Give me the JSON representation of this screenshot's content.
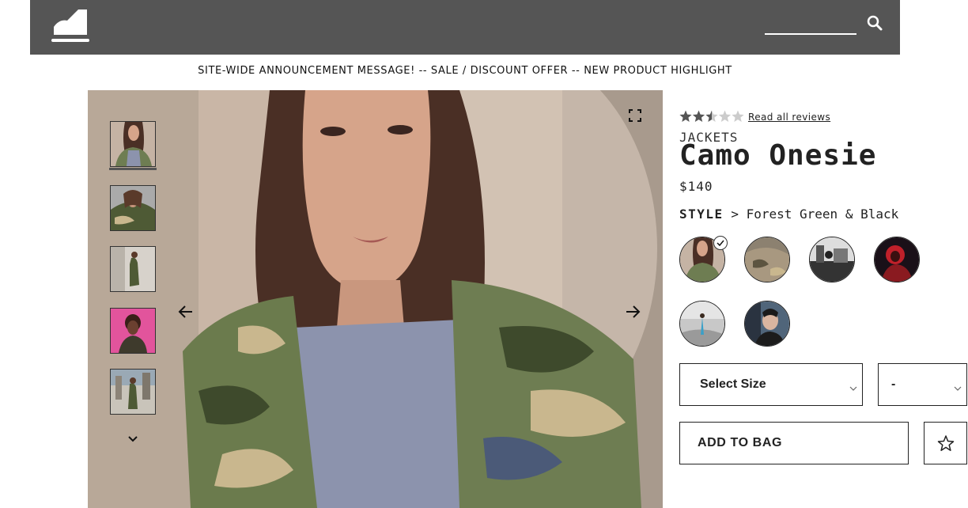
{
  "header": {
    "logo_icon": "logo-icon",
    "search": {
      "value": "",
      "placeholder": "",
      "icon": "search-icon"
    }
  },
  "announcement": "SITE-WIDE ANNOUNCEMENT MESSAGE! -- SALE / DISCOUNT OFFER -- NEW PRODUCT HIGHLIGHT",
  "gallery": {
    "thumbnails": [
      "thumb-1",
      "thumb-2",
      "thumb-3",
      "thumb-4",
      "thumb-5"
    ],
    "active_index": 0,
    "icons": {
      "expand": "expand-icon",
      "prev": "arrow-left-icon",
      "next": "arrow-right-icon",
      "more": "chevron-down-icon"
    }
  },
  "product": {
    "rating": 2.5,
    "rating_max": 5,
    "reviews_link": "Read all reviews",
    "category": "JACKETS",
    "name": "Camo Onesie",
    "price": "$140",
    "style_label": "STYLE",
    "style_separator": ">",
    "style_value": "Forest Green & Black",
    "swatches_count": 6,
    "selected_swatch": 0,
    "size_select": {
      "value": "Select Size"
    },
    "qty_select": {
      "value": "-"
    },
    "add_to_bag": "ADD TO BAG",
    "favorite_icon": "star-outline-icon"
  },
  "colors": {
    "header_bg": "#555555",
    "text": "#222222",
    "star_filled": "#555555",
    "star_empty": "#cccccc"
  }
}
